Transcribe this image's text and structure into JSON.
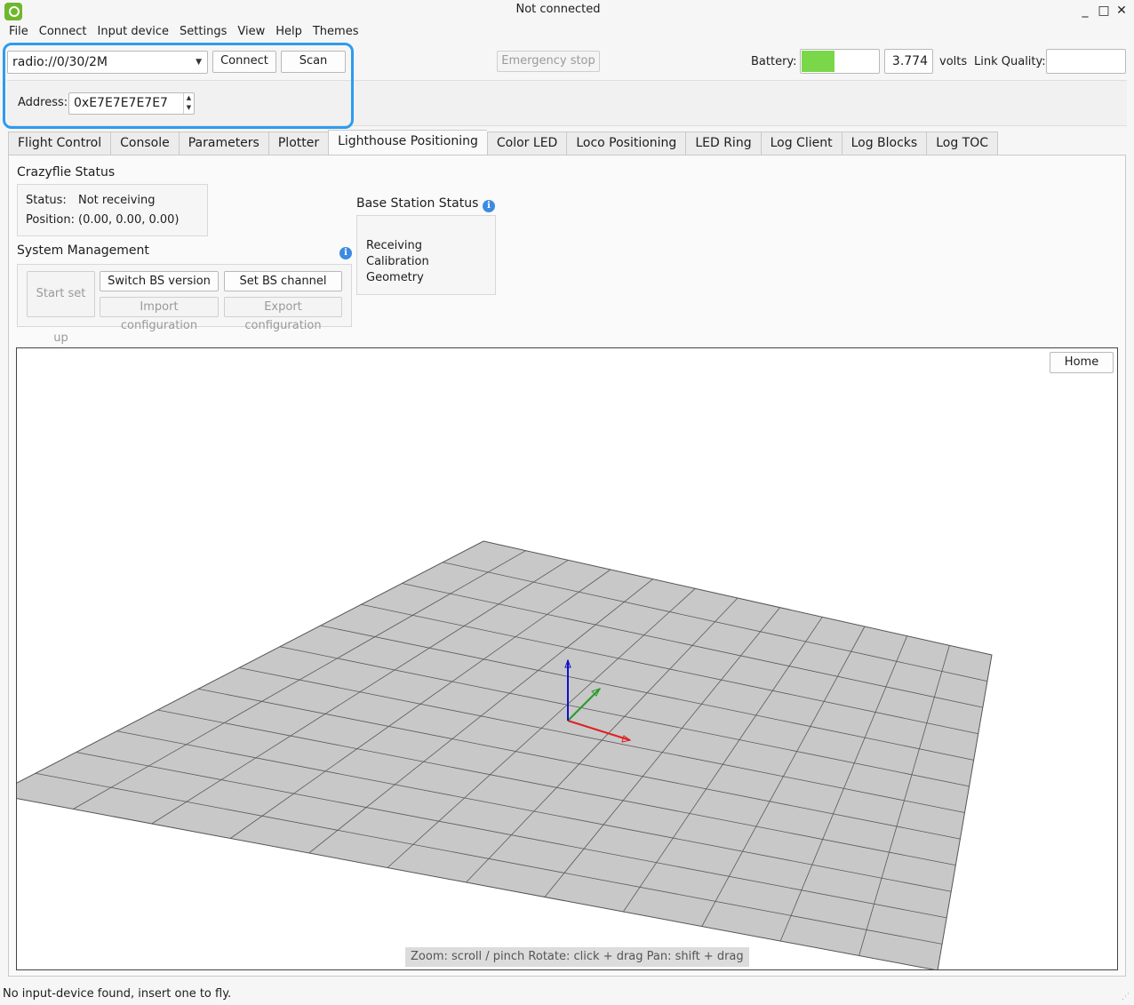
{
  "window": {
    "title": "Not connected",
    "controls": [
      "_",
      "□",
      "✕"
    ]
  },
  "menu": [
    "File",
    "Connect",
    "Input device",
    "Settings",
    "View",
    "Help",
    "Themes"
  ],
  "toolbar": {
    "uri": "radio://0/30/2M",
    "connect_label": "Connect",
    "scan_label": "Scan",
    "emergency_label": "Emergency stop",
    "battery_label": "Battery:",
    "battery_level": 0.42,
    "voltage": "3.774",
    "volts_label": "volts",
    "link_quality_label": "Link Quality:",
    "address_label": "Address:",
    "address_value": "0xE7E7E7E7E7"
  },
  "tabs": [
    "Flight Control",
    "Console",
    "Parameters",
    "Plotter",
    "Lighthouse Positioning",
    "Color LED",
    "Loco Positioning",
    "LED Ring",
    "Log Client",
    "Log Blocks",
    "Log TOC"
  ],
  "active_tab": "Lighthouse Positioning",
  "crazyflie_status": {
    "title": "Crazyflie Status",
    "status_label": "Status:",
    "status_value": "Not receiving",
    "position_label": "Position:",
    "position_value": "(0.00, 0.00, 0.00)"
  },
  "system_management": {
    "title": "System Management",
    "start_setup": "Start set up",
    "switch_bs": "Switch BS version",
    "set_bs_channel": "Set BS channel",
    "import_config": "Import configuration",
    "export_config": "Export configuration"
  },
  "base_station_status": {
    "title": "Base Station Status",
    "rows": [
      "Receiving",
      "Calibration",
      "Geometry"
    ]
  },
  "viewer": {
    "home_label": "Home",
    "hint": "Zoom: scroll / pinch   Rotate: click + drag   Pan: shift + drag"
  },
  "statusbar": "No input-device found, insert one to fly.",
  "colors": {
    "accent": "#2e9bf0",
    "battery": "#7bd74a",
    "grid_floor": "#c8c8c8",
    "axis_x": "#e02020",
    "axis_y": "#2a9a2a",
    "axis_z": "#1010c8"
  }
}
